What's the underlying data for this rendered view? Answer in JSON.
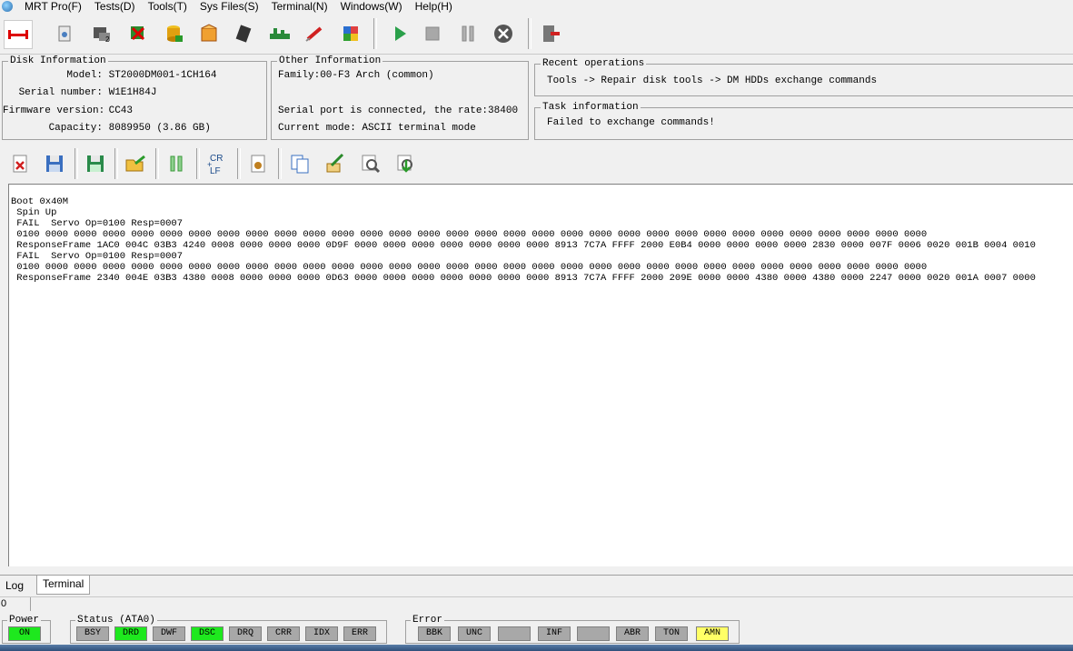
{
  "menu": [
    "MRT Pro(F)",
    "Tests(D)",
    "Tools(T)",
    "Sys Files(S)",
    "Terminal(N)",
    "Windows(W)",
    "Help(H)"
  ],
  "disk_info": {
    "title": "Disk Information",
    "model_label": "Model:",
    "model": "ST2000DM001-1CH164",
    "serial_label": "Serial number:",
    "serial": "W1E1H84J",
    "firmware_label": "Firmware version:",
    "firmware": "CC43",
    "capacity_label": "Capacity:",
    "capacity": "8089950 (3.86 GB)"
  },
  "other_info": {
    "title": "Other Information",
    "family": "Family:00-F3 Arch (common)",
    "serial_port": "Serial port is connected, the rate:38400",
    "mode": "Current mode: ASCII terminal mode"
  },
  "recent": {
    "title": "Recent operations",
    "text": "Tools -> Repair disk tools -> DM HDDs exchange commands"
  },
  "task": {
    "title": "Task information",
    "text": "Failed to exchange commands!"
  },
  "terminal_lines": [
    "Boot 0x40M",
    " Spin Up",
    " FAIL  Servo Op=0100 Resp=0007",
    " 0100 0000 0000 0000 0000 0000 0000 0000 0000 0000 0000 0000 0000 0000 0000 0000 0000 0000 0000 0000 0000 0000 0000 0000 0000 0000 0000 0000 0000 0000 0000 0000",
    " ResponseFrame 1AC0 004C 03B3 4240 0008 0000 0000 0000 0D9F 0000 0000 0000 0000 0000 0000 0000 8913 7C7A FFFF 2000 E0B4 0000 0000 0000 0000 2830 0000 007F 0006 0020 001B 0004 0010",
    " FAIL  Servo Op=0100 Resp=0007",
    " 0100 0000 0000 0000 0000 0000 0000 0000 0000 0000 0000 0000 0000 0000 0000 0000 0000 0000 0000 0000 0000 0000 0000 0000 0000 0000 0000 0000 0000 0000 0000 0000",
    " ResponseFrame 2340 004E 03B3 4380 0008 0000 0000 0000 0D63 0000 0000 0000 0000 0000 0000 0000 8913 7C7A FFFF 2000 209E 0000 0000 4380 0000 4380 0000 2247 0000 0020 001A 0007 0000"
  ],
  "tabs": {
    "log": "Log",
    "terminal": "Terminal"
  },
  "progress_value": "0",
  "power": {
    "title": "Power",
    "on": "ON"
  },
  "status": {
    "title": "Status (ATA0)",
    "flags": [
      {
        "label": "BSY",
        "active": false
      },
      {
        "label": "DRD",
        "active": true
      },
      {
        "label": "DWF",
        "active": false
      },
      {
        "label": "DSC",
        "active": true
      },
      {
        "label": "DRQ",
        "active": false
      },
      {
        "label": "CRR",
        "active": false
      },
      {
        "label": "IDX",
        "active": false
      },
      {
        "label": "ERR",
        "active": false
      }
    ]
  },
  "error": {
    "title": "Error",
    "flags": [
      {
        "label": "BBK"
      },
      {
        "label": "UNC"
      },
      {
        "label": ""
      },
      {
        "label": "INF"
      },
      {
        "label": ""
      },
      {
        "label": "ABR"
      },
      {
        "label": "TON"
      },
      {
        "label": "AMN",
        "warn": true
      }
    ]
  },
  "icons": {
    "toolbar1": [
      "disconnect-icon",
      "disk-info-icon",
      "pc3000-icon",
      "shutdown-icon",
      "database-icon",
      "package-icon",
      "chip-icon",
      "pcb-icon",
      "pen-icon",
      "cube-icon",
      "play-icon",
      "stop-icon",
      "pause-icon",
      "cancel-icon",
      "exit-icon"
    ],
    "toolbar2": [
      "clear-icon",
      "save-icon",
      "save-as-icon",
      "open-icon",
      "pause-icon",
      "crlf-icon",
      "settings-icon",
      "copy-icon",
      "edit-icon",
      "search-icon",
      "download-icon"
    ]
  }
}
